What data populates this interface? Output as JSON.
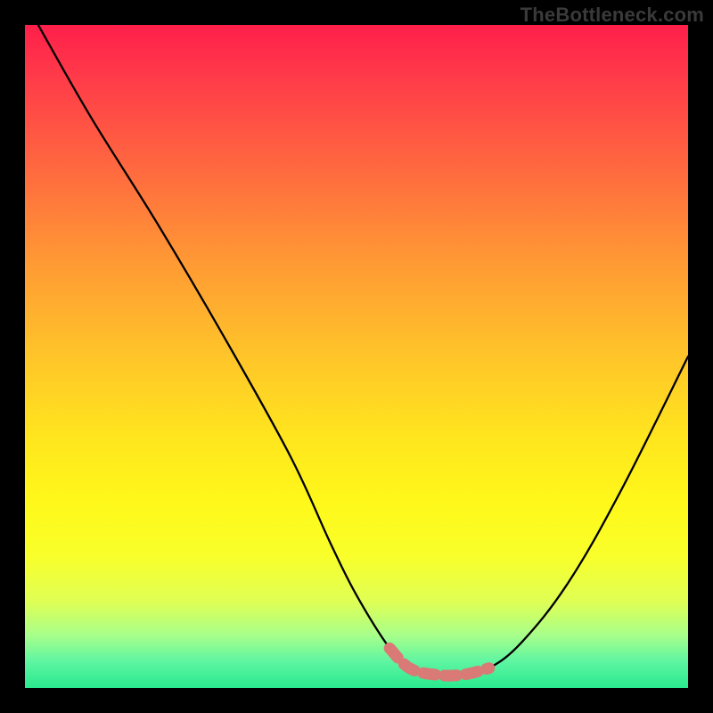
{
  "watermark": "TheBottleneck.com",
  "chart_data": {
    "type": "line",
    "title": "",
    "xlabel": "",
    "ylabel": "",
    "xlim": [
      0,
      100
    ],
    "ylim": [
      0,
      100
    ],
    "series": [
      {
        "name": "bottleneck-curve",
        "x": [
          2,
          10,
          20,
          30,
          40,
          46,
          50,
          55,
          58,
          62,
          66,
          70,
          75,
          82,
          90,
          100
        ],
        "y": [
          100,
          86,
          70,
          53,
          35,
          22,
          14,
          6,
          3,
          2,
          2,
          3,
          7,
          16,
          30,
          50
        ]
      }
    ],
    "highlight_zone": {
      "name": "optimal-range",
      "x": [
        55,
        58,
        62,
        66,
        70
      ],
      "y": [
        6,
        3,
        2,
        2,
        3
      ]
    },
    "gradient_stops": [
      {
        "pos": 0.0,
        "color": "#ff1f4a"
      },
      {
        "pos": 0.22,
        "color": "#ff6a3f"
      },
      {
        "pos": 0.5,
        "color": "#ffc529"
      },
      {
        "pos": 0.72,
        "color": "#fff81a"
      },
      {
        "pos": 0.92,
        "color": "#a8ff8a"
      },
      {
        "pos": 1.0,
        "color": "#29e98e"
      }
    ]
  }
}
